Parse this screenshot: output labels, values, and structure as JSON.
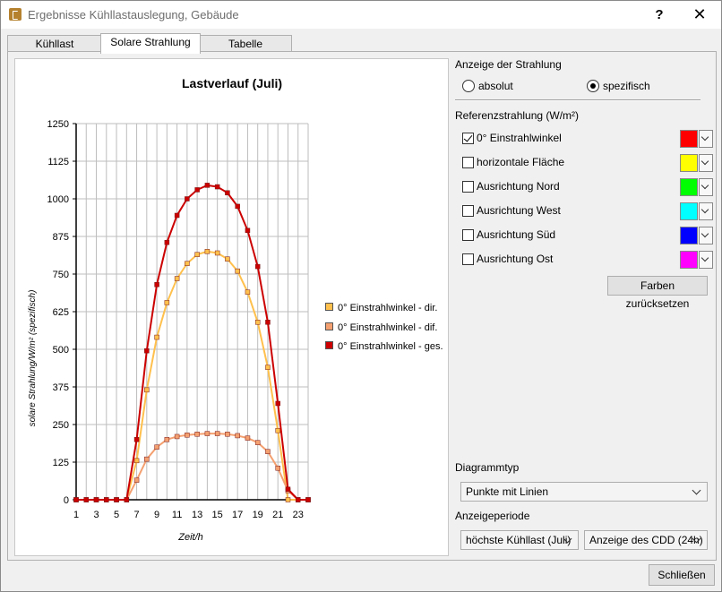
{
  "window": {
    "title": "Ergebnisse Kühllastauslegung, Gebäude",
    "help_label": "?",
    "close_label": "✕",
    "app_icon": "app-logo-icon"
  },
  "tabs": [
    {
      "label": "Kühllast"
    },
    {
      "label": "Solare Strahlung"
    },
    {
      "label": "Tabelle"
    }
  ],
  "radiation_display": {
    "heading": "Anzeige der Strahlung",
    "options": [
      {
        "label": "absolut",
        "checked": false
      },
      {
        "label": "spezifisch",
        "checked": true
      }
    ]
  },
  "reference": {
    "heading": "Referenzstrahlung (W/m²)",
    "items": [
      {
        "label": "0° Einstrahlwinkel",
        "checked": true,
        "color": "#ff0000"
      },
      {
        "label": "horizontale Fläche",
        "checked": false,
        "color": "#ffff00"
      },
      {
        "label": "Ausrichtung Nord",
        "checked": false,
        "color": "#00ff00"
      },
      {
        "label": "Ausrichtung West",
        "checked": false,
        "color": "#00ffff"
      },
      {
        "label": "Ausrichtung Süd",
        "checked": false,
        "color": "#0000ff"
      },
      {
        "label": "Ausrichtung Ost",
        "checked": false,
        "color": "#ff00ff"
      }
    ],
    "reset_button": "Farben zurücksetzen"
  },
  "diagram_type": {
    "heading": "Diagrammtyp",
    "value": "Punkte mit Linien"
  },
  "display_period": {
    "heading": "Anzeigeperiode",
    "period_value": "höchste Kühllast (Juli)",
    "mode_value": "Anzeige des CDD (24h)"
  },
  "footer": {
    "close_button": "Schließen"
  },
  "chart_data": {
    "type": "line",
    "title": "Lastverlauf (Juli)",
    "xlabel": "Zeit/h",
    "ylabel": "solare Strahlung/W/m² (spezifisch)",
    "ylim": [
      0,
      1250
    ],
    "xlim": [
      1,
      24
    ],
    "yticks": [
      "0",
      "125",
      "250",
      "375",
      "500",
      "625",
      "750",
      "875",
      "1000",
      "1125",
      "1250"
    ],
    "xticks": [
      "1",
      "3",
      "5",
      "7",
      "9",
      "11",
      "13",
      "15",
      "17",
      "19",
      "21",
      "23"
    ],
    "grid": true,
    "legend_position": "right",
    "x": [
      1,
      2,
      3,
      4,
      5,
      6,
      7,
      8,
      9,
      10,
      11,
      12,
      13,
      14,
      15,
      16,
      17,
      18,
      19,
      20,
      21,
      22,
      23,
      24
    ],
    "series": [
      {
        "name": "0° Einstrahlwinkel - dir.",
        "color": "#ffc04d",
        "values": [
          0,
          0,
          0,
          0,
          0,
          0,
          130,
          365,
          540,
          655,
          735,
          785,
          815,
          825,
          820,
          800,
          760,
          690,
          590,
          440,
          230,
          0,
          0,
          0
        ]
      },
      {
        "name": "0° Einstrahlwinkel - dif.",
        "color": "#f4a070",
        "values": [
          0,
          0,
          0,
          0,
          0,
          0,
          65,
          135,
          175,
          200,
          210,
          215,
          218,
          220,
          220,
          218,
          213,
          205,
          190,
          160,
          105,
          30,
          0,
          0
        ]
      },
      {
        "name": "0° Einstrahlwinkel - ges.",
        "color": "#cc0000",
        "values": [
          0,
          0,
          0,
          0,
          0,
          0,
          200,
          495,
          715,
          855,
          945,
          1000,
          1030,
          1045,
          1040,
          1020,
          975,
          895,
          775,
          590,
          320,
          35,
          0,
          0
        ]
      }
    ]
  }
}
